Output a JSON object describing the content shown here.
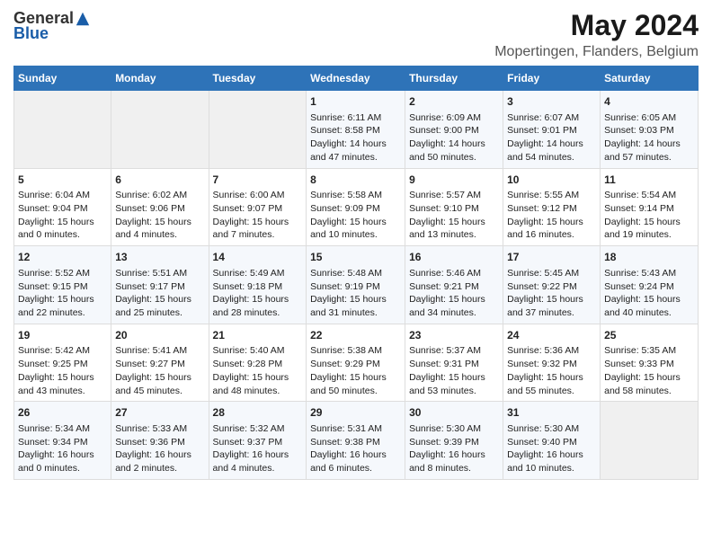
{
  "header": {
    "logo_general": "General",
    "logo_blue": "Blue",
    "title": "May 2024",
    "subtitle": "Mopertingen, Flanders, Belgium"
  },
  "days_of_week": [
    "Sunday",
    "Monday",
    "Tuesday",
    "Wednesday",
    "Thursday",
    "Friday",
    "Saturday"
  ],
  "weeks": [
    [
      {
        "day": "",
        "empty": true
      },
      {
        "day": "",
        "empty": true
      },
      {
        "day": "",
        "empty": true
      },
      {
        "day": "1",
        "sunrise": "6:11 AM",
        "sunset": "8:58 PM",
        "daylight": "14 hours and 47 minutes."
      },
      {
        "day": "2",
        "sunrise": "6:09 AM",
        "sunset": "9:00 PM",
        "daylight": "14 hours and 50 minutes."
      },
      {
        "day": "3",
        "sunrise": "6:07 AM",
        "sunset": "9:01 PM",
        "daylight": "14 hours and 54 minutes."
      },
      {
        "day": "4",
        "sunrise": "6:05 AM",
        "sunset": "9:03 PM",
        "daylight": "14 hours and 57 minutes."
      }
    ],
    [
      {
        "day": "5",
        "sunrise": "6:04 AM",
        "sunset": "9:04 PM",
        "daylight": "15 hours and 0 minutes."
      },
      {
        "day": "6",
        "sunrise": "6:02 AM",
        "sunset": "9:06 PM",
        "daylight": "15 hours and 4 minutes."
      },
      {
        "day": "7",
        "sunrise": "6:00 AM",
        "sunset": "9:07 PM",
        "daylight": "15 hours and 7 minutes."
      },
      {
        "day": "8",
        "sunrise": "5:58 AM",
        "sunset": "9:09 PM",
        "daylight": "15 hours and 10 minutes."
      },
      {
        "day": "9",
        "sunrise": "5:57 AM",
        "sunset": "9:10 PM",
        "daylight": "15 hours and 13 minutes."
      },
      {
        "day": "10",
        "sunrise": "5:55 AM",
        "sunset": "9:12 PM",
        "daylight": "15 hours and 16 minutes."
      },
      {
        "day": "11",
        "sunrise": "5:54 AM",
        "sunset": "9:14 PM",
        "daylight": "15 hours and 19 minutes."
      }
    ],
    [
      {
        "day": "12",
        "sunrise": "5:52 AM",
        "sunset": "9:15 PM",
        "daylight": "15 hours and 22 minutes."
      },
      {
        "day": "13",
        "sunrise": "5:51 AM",
        "sunset": "9:17 PM",
        "daylight": "15 hours and 25 minutes."
      },
      {
        "day": "14",
        "sunrise": "5:49 AM",
        "sunset": "9:18 PM",
        "daylight": "15 hours and 28 minutes."
      },
      {
        "day": "15",
        "sunrise": "5:48 AM",
        "sunset": "9:19 PM",
        "daylight": "15 hours and 31 minutes."
      },
      {
        "day": "16",
        "sunrise": "5:46 AM",
        "sunset": "9:21 PM",
        "daylight": "15 hours and 34 minutes."
      },
      {
        "day": "17",
        "sunrise": "5:45 AM",
        "sunset": "9:22 PM",
        "daylight": "15 hours and 37 minutes."
      },
      {
        "day": "18",
        "sunrise": "5:43 AM",
        "sunset": "9:24 PM",
        "daylight": "15 hours and 40 minutes."
      }
    ],
    [
      {
        "day": "19",
        "sunrise": "5:42 AM",
        "sunset": "9:25 PM",
        "daylight": "15 hours and 43 minutes."
      },
      {
        "day": "20",
        "sunrise": "5:41 AM",
        "sunset": "9:27 PM",
        "daylight": "15 hours and 45 minutes."
      },
      {
        "day": "21",
        "sunrise": "5:40 AM",
        "sunset": "9:28 PM",
        "daylight": "15 hours and 48 minutes."
      },
      {
        "day": "22",
        "sunrise": "5:38 AM",
        "sunset": "9:29 PM",
        "daylight": "15 hours and 50 minutes."
      },
      {
        "day": "23",
        "sunrise": "5:37 AM",
        "sunset": "9:31 PM",
        "daylight": "15 hours and 53 minutes."
      },
      {
        "day": "24",
        "sunrise": "5:36 AM",
        "sunset": "9:32 PM",
        "daylight": "15 hours and 55 minutes."
      },
      {
        "day": "25",
        "sunrise": "5:35 AM",
        "sunset": "9:33 PM",
        "daylight": "15 hours and 58 minutes."
      }
    ],
    [
      {
        "day": "26",
        "sunrise": "5:34 AM",
        "sunset": "9:34 PM",
        "daylight": "16 hours and 0 minutes."
      },
      {
        "day": "27",
        "sunrise": "5:33 AM",
        "sunset": "9:36 PM",
        "daylight": "16 hours and 2 minutes."
      },
      {
        "day": "28",
        "sunrise": "5:32 AM",
        "sunset": "9:37 PM",
        "daylight": "16 hours and 4 minutes."
      },
      {
        "day": "29",
        "sunrise": "5:31 AM",
        "sunset": "9:38 PM",
        "daylight": "16 hours and 6 minutes."
      },
      {
        "day": "30",
        "sunrise": "5:30 AM",
        "sunset": "9:39 PM",
        "daylight": "16 hours and 8 minutes."
      },
      {
        "day": "31",
        "sunrise": "5:30 AM",
        "sunset": "9:40 PM",
        "daylight": "16 hours and 10 minutes."
      },
      {
        "day": "",
        "empty": true
      }
    ]
  ],
  "labels": {
    "sunrise": "Sunrise:",
    "sunset": "Sunset:",
    "daylight": "Daylight:"
  }
}
